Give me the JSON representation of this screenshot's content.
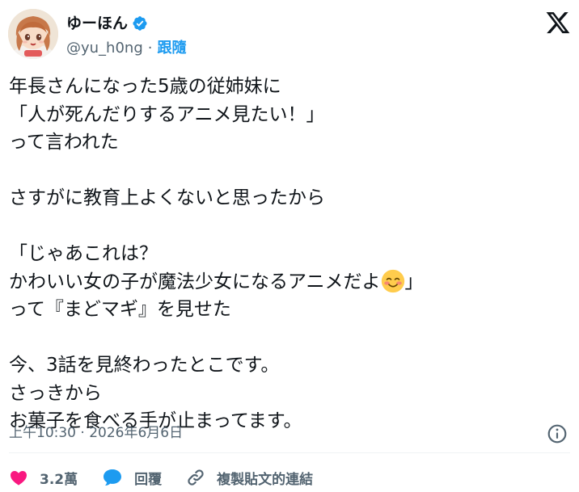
{
  "user": {
    "display_name": "ゆーほん",
    "handle": "@yu_h0ng",
    "separator": "·",
    "follow_label": "跟隨"
  },
  "tweet": {
    "lines": [
      "年長さんになった5歳の従姉妹に",
      "「人が死んだりするアニメ見たい！」",
      "って言われた",
      "",
      "さすがに教育上よくないと思ったから",
      "",
      "「じゃあこれは？",
      "かわいい女の子が魔法少女になるアニメだよ",
      "って『まどマギ』を見せた",
      "",
      "今、3話を見終わったとこです。",
      "さっきから",
      "お菓子を食べる手が止まってます。"
    ],
    "line8_suffix": "」",
    "emoji_name": "smiling-face-emoji"
  },
  "meta": {
    "time": "上午10:30",
    "separator": "·",
    "date": "2026年6月6日"
  },
  "actions": {
    "likes": "3.2萬",
    "reply_label": "回覆",
    "copy_link_label": "複製貼文的連結"
  },
  "colors": {
    "text": "#0f1419",
    "secondary": "#536471",
    "accent": "#1d9bf0",
    "like": "#f91880"
  },
  "icons": {
    "logo": "x-logo-icon",
    "verified": "verified-badge-icon",
    "info": "info-icon",
    "like": "heart-icon",
    "reply": "speech-bubble-icon",
    "link": "link-icon"
  }
}
